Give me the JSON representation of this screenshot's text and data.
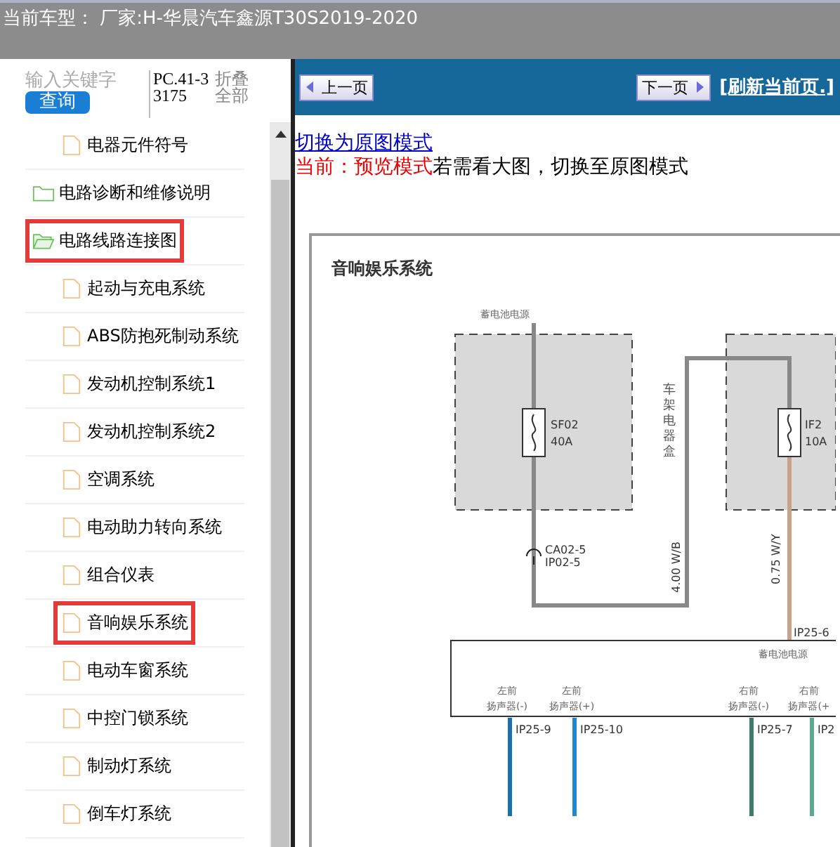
{
  "header": {
    "title": "当前车型： 厂家:H-华晨汽车鑫源T30S2019-2020"
  },
  "sidebar": {
    "search": {
      "placeholder": "输入关键字",
      "button": "查询"
    },
    "code": "PC.41-33175",
    "collapse_all": "折叠全部",
    "tree": [
      {
        "kind": "file",
        "label": "电器元件符号",
        "highlighted": false
      },
      {
        "kind": "folder",
        "label": "电路诊断和维修说明",
        "highlighted": false,
        "expanded": false
      },
      {
        "kind": "folder",
        "label": "电路线路连接图",
        "highlighted": true,
        "expanded": true,
        "children": [
          {
            "kind": "file",
            "label": "起动与充电系统",
            "highlighted": false
          },
          {
            "kind": "file",
            "label": "ABS防抱死制动系统",
            "highlighted": false
          },
          {
            "kind": "file",
            "label": "发动机控制系统1",
            "highlighted": false
          },
          {
            "kind": "file",
            "label": "发动机控制系统2",
            "highlighted": false
          },
          {
            "kind": "file",
            "label": "空调系统",
            "highlighted": false
          },
          {
            "kind": "file",
            "label": "电动助力转向系统",
            "highlighted": false
          },
          {
            "kind": "file",
            "label": "组合仪表",
            "highlighted": false
          },
          {
            "kind": "file",
            "label": "音响娱乐系统",
            "highlighted": true
          },
          {
            "kind": "file",
            "label": "电动车窗系统",
            "highlighted": false
          },
          {
            "kind": "file",
            "label": "中控门锁系统",
            "highlighted": false
          },
          {
            "kind": "file",
            "label": "制动灯系统",
            "highlighted": false
          },
          {
            "kind": "file",
            "label": "倒车灯系统",
            "highlighted": false
          }
        ]
      }
    ]
  },
  "toolbar": {
    "prev": "上一页",
    "next": "下一页",
    "refresh": "[刷新当前页.]"
  },
  "mode": {
    "switch_link": "切换为原图模式",
    "current": "当前：预览模式",
    "hint": "若需看大图，切换至原图模式"
  },
  "diagram": {
    "title": "音响娱乐系统",
    "battery_label": "蓄电池电源",
    "housing_label": "车架电器盒",
    "fuses": [
      {
        "code": "SF02",
        "rating": "40A"
      },
      {
        "code": "IF2",
        "rating": "10A"
      }
    ],
    "connector": [
      "CA02-5",
      "IP02-5"
    ],
    "wire_labels": [
      "4.00 W/B",
      "0.75 W/Y"
    ],
    "module_pin": "IP25-6",
    "module_label": "蓄电池电源",
    "speakers": [
      {
        "position": "左前",
        "name": "扬声器(-)",
        "pin": "IP25-9",
        "color": "#1a6fae"
      },
      {
        "position": "左前",
        "name": "扬声器(+)",
        "pin": "IP25-10",
        "color": "#1e88d0"
      },
      {
        "position": "右前",
        "name": "扬声器(-)",
        "pin": "IP25-7",
        "color": "#3f7a6a"
      },
      {
        "position": "右前",
        "name": "扬声器(+",
        "pin": "IP2",
        "color": "#5aab8e"
      }
    ]
  }
}
